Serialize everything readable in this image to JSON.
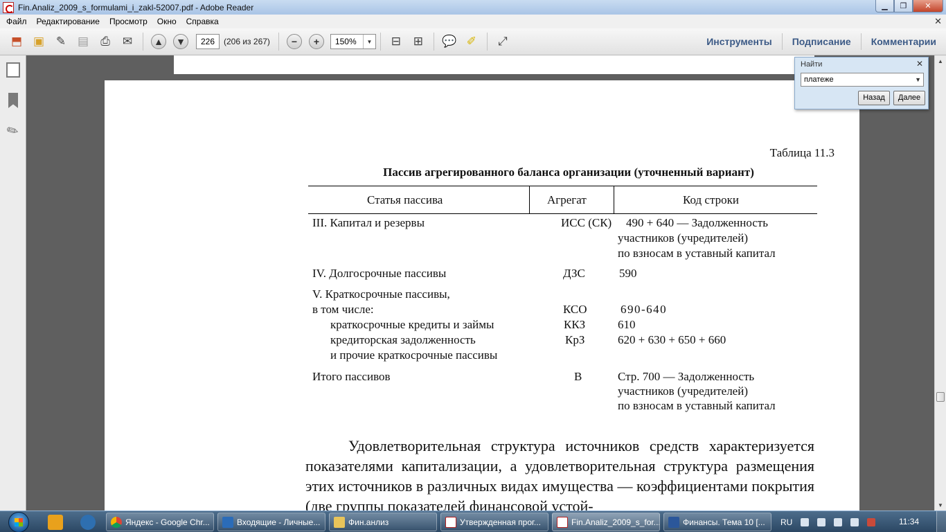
{
  "window": {
    "title": "Fin.Analiz_2009_s_formulami_i_zakl-52007.pdf - Adobe Reader"
  },
  "menu": [
    "Файл",
    "Редактирование",
    "Просмотр",
    "Окно",
    "Справка"
  ],
  "toolbar": {
    "page_number": "226",
    "page_count": "(206 из 267)",
    "zoom": "150%",
    "tabs": [
      "Инструменты",
      "Подписание",
      "Комментарии"
    ]
  },
  "find": {
    "title": "Найти",
    "query": "платеже",
    "back_label": "Назад",
    "next_label": "Далее"
  },
  "document": {
    "table_number": "Таблица  11.3",
    "table_title": "Пассив агрегированного баланса организации (уточненный вариант)",
    "headers": [
      "Статья  пассива",
      "Агрегат",
      "Код строки"
    ],
    "rows": [
      {
        "article": [
          "III.  Капитал и резервы"
        ],
        "aggregate": "ИСС (СК)",
        "code": [
          "490 + 640 — Задолженность",
          "участников  (учредителей)",
          "по взносам в уставный капитал"
        ]
      },
      {
        "article": [
          "IV. Долгосрочные пассивы"
        ],
        "aggregate": "ДЗС",
        "code": [
          "590"
        ]
      },
      {
        "article": [
          "V.  Краткосрочные пассивы,",
          "в том числе:"
        ],
        "aggregate": "КСО",
        "code": [
          "690-640"
        ]
      },
      {
        "article": [
          "краткосрочные кредиты  и займы"
        ],
        "aggregate": "ККЗ",
        "code": [
          "610"
        ]
      },
      {
        "article": [
          "кредиторская  задолженность",
          "и прочие краткосрочные пассивы"
        ],
        "aggregate": "КрЗ",
        "code": [
          "620 + 630 + 650 + 660"
        ]
      },
      {
        "article": [
          "Итого  пассивов"
        ],
        "aggregate": "В",
        "code": [
          "Стр. 700 — Задолженность",
          "участников  (учредителей)",
          "по взносам в уставный капитал"
        ]
      }
    ],
    "paragraph": "Удовлетворительная структура источников средств характеризуется показателями капитализации, а удовлетворительная структура размещения этих источников в различных видах имущества — коэффициентами покрытия (две группы показателей финансовой устой-"
  },
  "taskbar": {
    "tasks": [
      "Яндекс - Google Chr...",
      "Входящие - Личные...",
      "Фин.анлиз",
      "Утвержденная прог...",
      "Fin.Analiz_2009_s_for...",
      "Финансы. Тема 10 [..."
    ],
    "language": "RU",
    "clock": "11:34"
  }
}
